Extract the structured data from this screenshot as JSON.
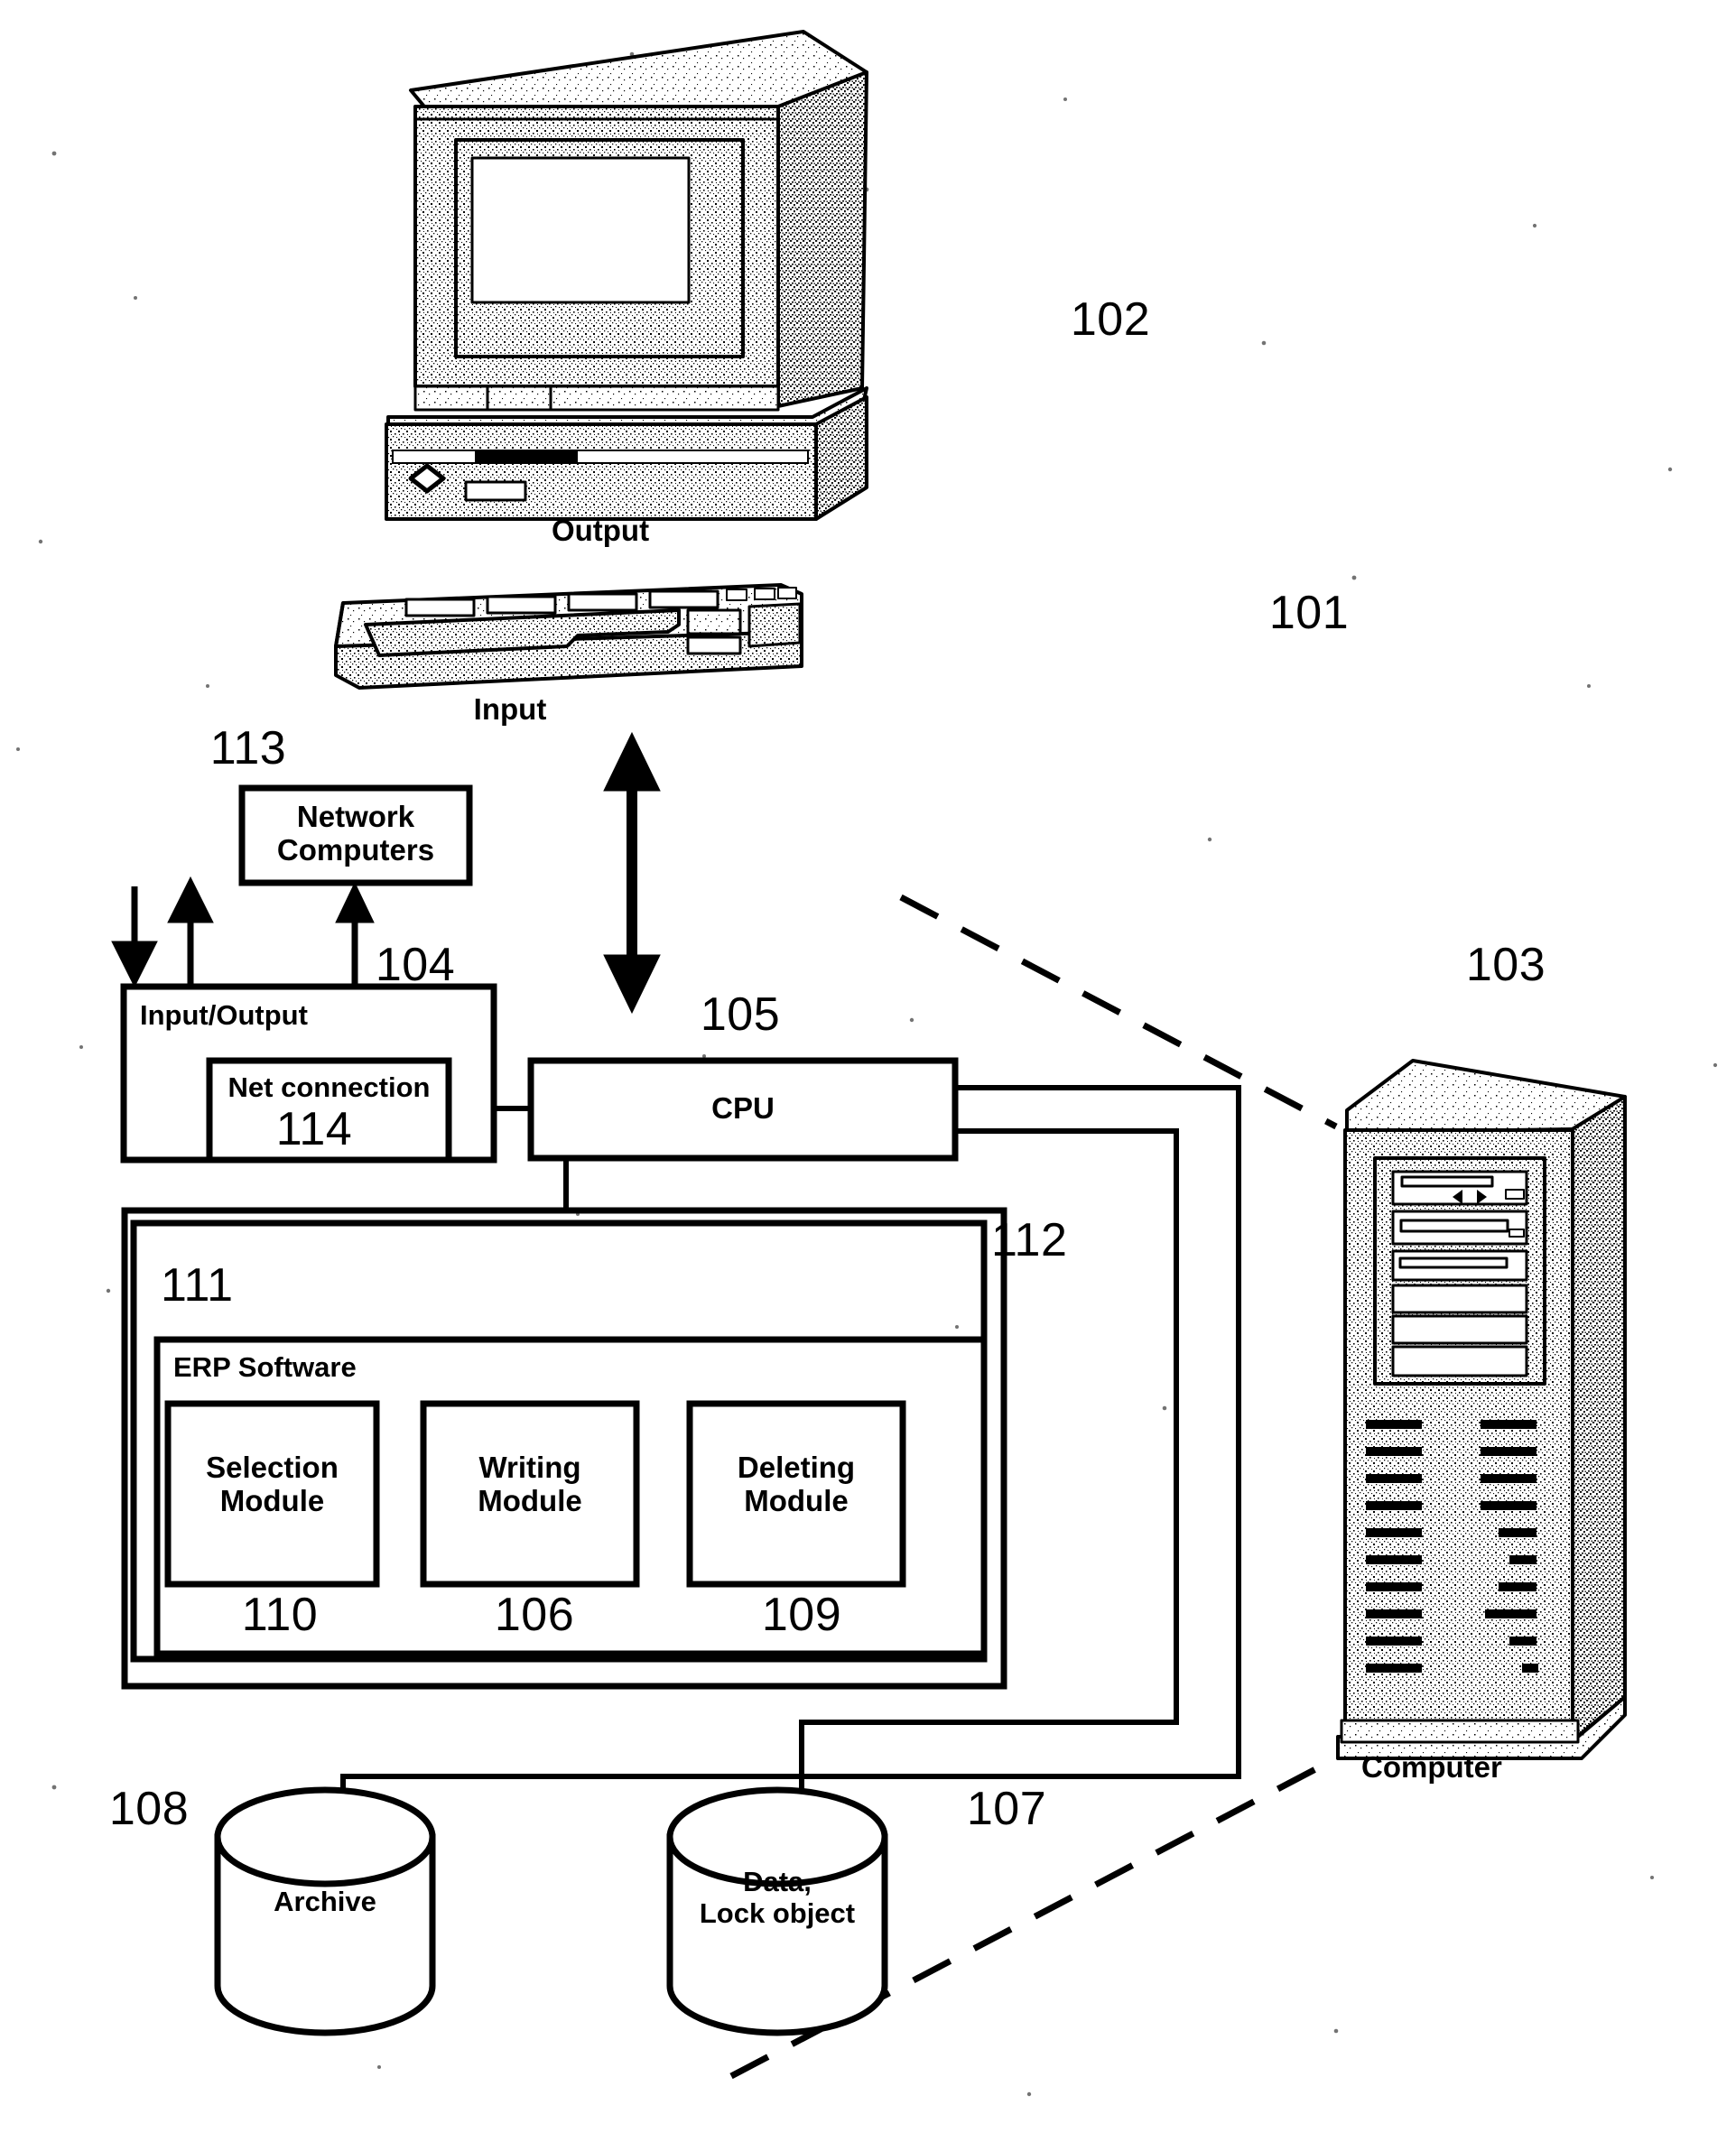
{
  "figure": {
    "kind": "patent-block-diagram",
    "background_color": "#ffffff",
    "ink_color": "#000000"
  },
  "devices": {
    "monitor": {
      "label": "Output",
      "ref": "102",
      "icon": "crt-monitor-icon"
    },
    "keyboard": {
      "label": "Input",
      "ref": "101",
      "icon": "keyboard-icon"
    },
    "server": {
      "label": "Computer",
      "ref": "103",
      "icon": "tower-server-icon"
    }
  },
  "blocks": {
    "network_computers": {
      "label": "Network\nComputers",
      "ref": "113"
    },
    "input_output": {
      "label": "Input/Output",
      "ref": "104"
    },
    "net_connection": {
      "label": "Net connection",
      "ref": "114"
    },
    "cpu": {
      "label": "CPU",
      "ref": "105"
    },
    "outer_system": {
      "ref": "112"
    },
    "memory": {
      "ref": "111"
    },
    "erp_software": {
      "label": "ERP Software"
    },
    "selection_module": {
      "label": "Selection\nModule",
      "ref": "110"
    },
    "writing_module": {
      "label": "Writing\nModule",
      "ref": "106"
    },
    "deleting_module": {
      "label": "Deleting\nModule",
      "ref": "109"
    }
  },
  "stores": {
    "archive": {
      "label": "Archive",
      "ref": "108"
    },
    "data_lock_object": {
      "label": "Data,\nLock object",
      "ref": "107"
    }
  },
  "connectors": {
    "keyboard_to_cpu": "bidirectional-vertical-arrow",
    "net_to_io": "bidirectional-vertical-arrow",
    "io_in": "down-arrow",
    "io_out": "up-arrow",
    "system_boundary": "dashed-diagonal-line"
  }
}
